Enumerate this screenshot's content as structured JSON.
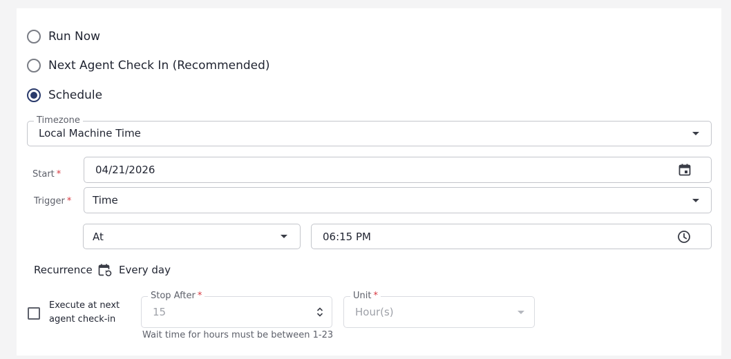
{
  "execution": {
    "options": [
      {
        "label": "Run Now",
        "checked": false
      },
      {
        "label": "Next Agent Check In (Recommended)",
        "checked": false
      },
      {
        "label": "Schedule",
        "checked": true
      }
    ]
  },
  "schedule": {
    "timezone": {
      "label": "Timezone",
      "value": "Local Machine Time"
    },
    "start": {
      "label": "Start",
      "required_mark": "*",
      "value": "04/21/2026"
    },
    "trigger": {
      "label": "Trigger",
      "required_mark": "*",
      "value": "Time"
    },
    "at": {
      "value": "At"
    },
    "time": {
      "value": "06:15 PM"
    },
    "recurrence": {
      "label": "Recurrence",
      "value": "Every day"
    },
    "execute_next": {
      "label_line1": "Execute at next",
      "label_line2": "agent check-in",
      "checked": false
    },
    "stop_after": {
      "label": "Stop After",
      "required_mark": "*",
      "value": "15"
    },
    "unit": {
      "label": "Unit",
      "required_mark": "*",
      "value": "Hour(s)"
    },
    "hint": "Wait time for hours must be between 1-23"
  },
  "colors": {
    "accent": "#2a3a6b",
    "required": "#d7373f",
    "border": "#c3c5cb"
  }
}
